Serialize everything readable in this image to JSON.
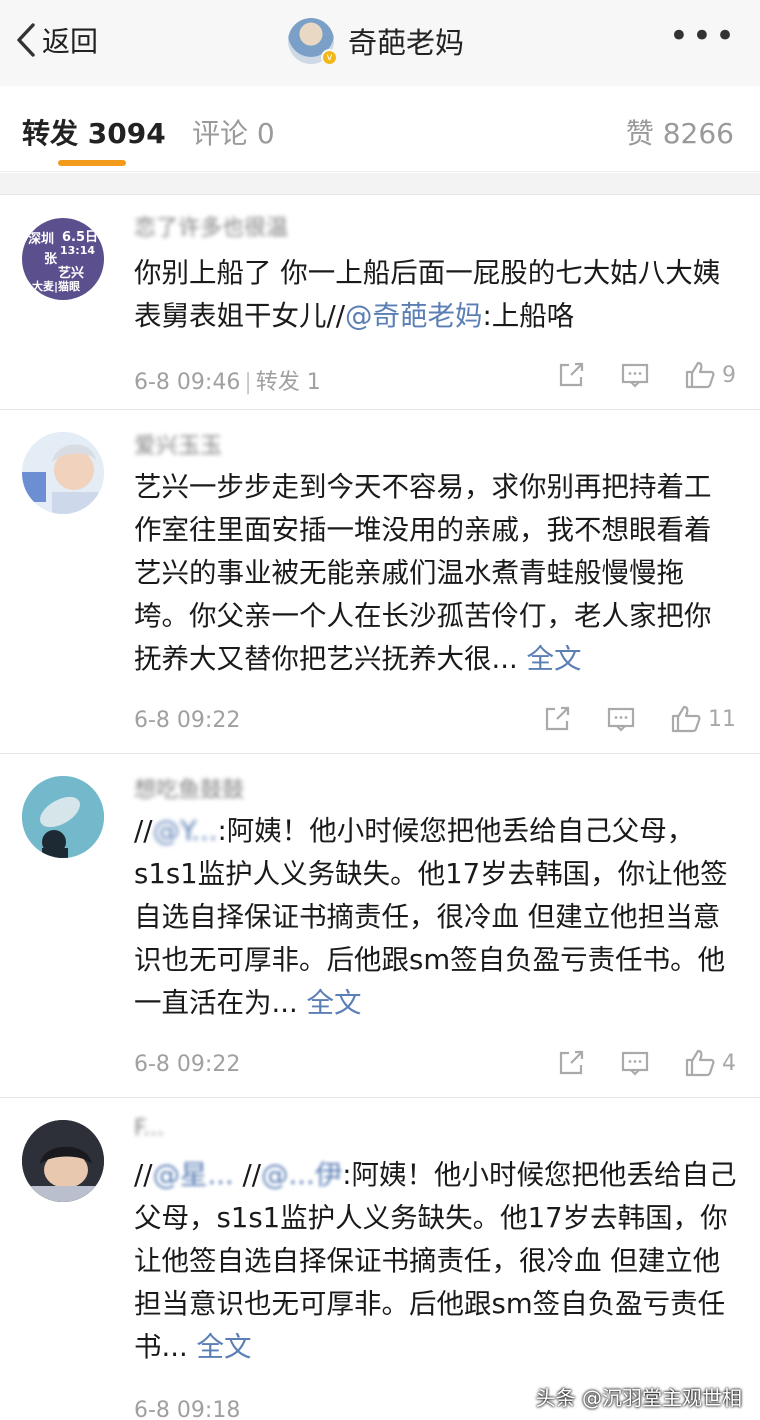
{
  "nav": {
    "back_label": "返回",
    "title": "奇葩老妈",
    "more": "•••"
  },
  "tabs": {
    "repost": "转发 3094",
    "comment": "评论 0",
    "like": "赞 8266"
  },
  "posts": [
    {
      "name": "恋了许多也很温",
      "avatar_text": [
        "深圳",
        "6.5日",
        "张",
        "13:14",
        "艺兴",
        "大麦|猫眼"
      ],
      "pre": "你别上船了 你一上船后面一屁股的七大姑八大姨表舅表姐干女儿//",
      "mention": "@奇葩老妈",
      "post": ":上船咯",
      "more": "",
      "time": "6-8 09:46",
      "reposts": "转发 1",
      "likes": "9"
    },
    {
      "name": "爱兴玉玉",
      "pre": "艺兴一步步走到今天不容易，求你别再把持着工作室往里面安插一堆没用的亲戚，我不想眼看着艺兴的事业被无能亲戚们温水煮青蛙般慢慢拖垮。你父亲一个人在长沙孤苦伶仃，老人家把你抚养大又替你把艺兴抚养大很...",
      "mention": "",
      "post": "",
      "more": "全文",
      "time": "6-8 09:22",
      "likes": "11"
    },
    {
      "name": "想吃鱼鼓鼓",
      "pre": "//",
      "mention": "@Y...",
      "post": ":阿姨！他小时候您把他丢给自己父母，s1s1监护人义务缺失。他17岁去韩国，你让他签自选自择保证书摘责任，很冷血 但建立他担当意识也无可厚非。后他跟sm签自负盈亏责任书。他一直活在为...",
      "more": "全文",
      "time": "6-8 09:22",
      "likes": "4"
    },
    {
      "name": "F...",
      "pre": "//",
      "mention": "@星... ",
      "post": "//",
      "mention2": "@...伊",
      "post2": ":阿姨！他小时候您把他丢给自己父母，s1s1监护人义务缺失。他17岁去韩国，你让他签自选自择保证书摘责任，很冷血 但建立他担当意识也无可厚非。后他跟sm签自负盈亏责任书...",
      "more": "全文",
      "time": "6-8 09:18"
    }
  ],
  "watermark": "头条 @沉羽堂主观世相"
}
